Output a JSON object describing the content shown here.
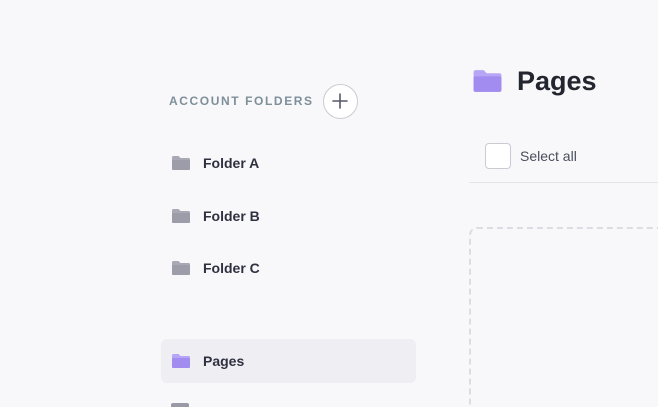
{
  "sidebar": {
    "heading": "ACCOUNT FOLDERS",
    "items": [
      {
        "label": "Folder A",
        "icon": "folder-icon",
        "active": false
      },
      {
        "label": "Folder B",
        "icon": "folder-icon",
        "active": false
      },
      {
        "label": "Folder C",
        "icon": "folder-icon",
        "active": false
      },
      {
        "label": "Pages",
        "icon": "folder-icon",
        "active": true
      }
    ]
  },
  "main": {
    "title": "Pages",
    "title_icon": "folder-icon",
    "select_all_label": "Select all"
  },
  "colors": {
    "folder_gray": "#a8a9b4",
    "folder_purple": "#a38cf0",
    "accent_heading": "#7d8f99",
    "active_bg": "#eeeef3"
  }
}
